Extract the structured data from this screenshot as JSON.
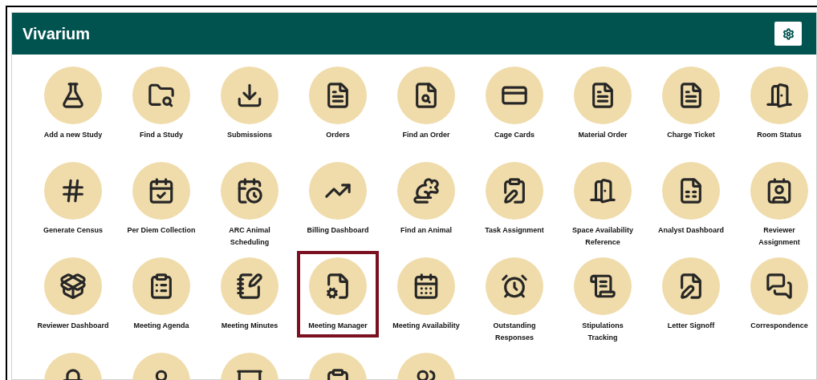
{
  "header": {
    "title": "Vivarium"
  },
  "tiles": [
    {
      "label": "Add a new Study",
      "selected": false
    },
    {
      "label": "Find a Study",
      "selected": false
    },
    {
      "label": "Submissions",
      "selected": false
    },
    {
      "label": "Orders",
      "selected": false
    },
    {
      "label": "Find an Order",
      "selected": false
    },
    {
      "label": "Cage Cards",
      "selected": false
    },
    {
      "label": "Material Order",
      "selected": false
    },
    {
      "label": "Charge Ticket",
      "selected": false
    },
    {
      "label": "Room Status",
      "selected": false
    },
    {
      "label": "Generate Census",
      "selected": false
    },
    {
      "label": "Per Diem Collection",
      "selected": false
    },
    {
      "label": "ARC Animal Scheduling",
      "selected": false
    },
    {
      "label": "Billing Dashboard",
      "selected": false
    },
    {
      "label": "Find an Animal",
      "selected": false
    },
    {
      "label": "Task Assignment",
      "selected": false
    },
    {
      "label": "Space Availability Reference",
      "selected": false
    },
    {
      "label": "Analyst Dashboard",
      "selected": false
    },
    {
      "label": "Reviewer Assignment",
      "selected": false
    },
    {
      "label": "Reviewer Dashboard",
      "selected": false
    },
    {
      "label": "Meeting Agenda",
      "selected": false
    },
    {
      "label": "Meeting Minutes",
      "selected": false
    },
    {
      "label": "Meeting Manager",
      "selected": true
    },
    {
      "label": "Meeting Availability",
      "selected": false
    },
    {
      "label": "Outstanding Responses",
      "selected": false
    },
    {
      "label": "Stipulations Tracking",
      "selected": false
    },
    {
      "label": "Letter Signoff",
      "selected": false
    },
    {
      "label": "Correspondence",
      "selected": false
    },
    {
      "selected": false
    },
    {
      "selected": false
    },
    {
      "selected": false
    },
    {
      "selected": false
    },
    {
      "selected": false
    }
  ]
}
